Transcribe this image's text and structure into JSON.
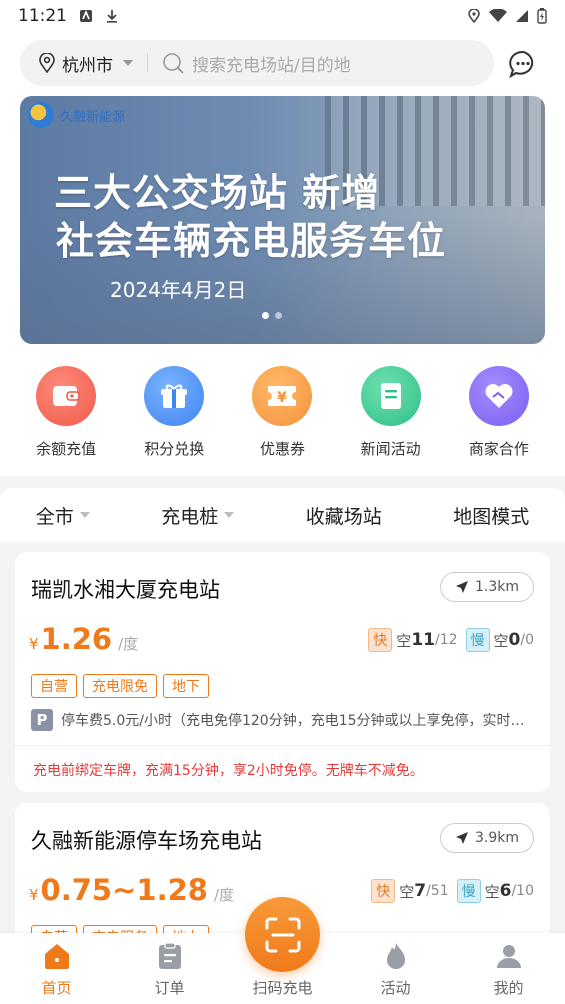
{
  "status_bar": {
    "time": "11:21"
  },
  "header": {
    "city": "杭州市",
    "search_placeholder": "搜索充电场站/目的地"
  },
  "banner": {
    "logo_text": "久融新能源",
    "headline_1": "三大公交场站 新增",
    "headline_2": "社会车辆充电服务车位",
    "date": "2024年4月2日",
    "slide_count": 2,
    "active_slide": 1
  },
  "quick_actions": [
    {
      "label": "余额充值",
      "icon": "wallet-icon",
      "color": "#f06a5a"
    },
    {
      "label": "积分兑换",
      "icon": "gift-icon",
      "color": "#4a8ff0"
    },
    {
      "label": "优惠券",
      "icon": "coupon-icon",
      "color": "#f59a3c"
    },
    {
      "label": "新闻活动",
      "icon": "news-icon",
      "color": "#3cc48e"
    },
    {
      "label": "商家合作",
      "icon": "handshake-icon",
      "color": "#8a6cf0"
    }
  ],
  "filter_tabs": [
    {
      "label": "全市",
      "dropdown": true
    },
    {
      "label": "充电桩",
      "dropdown": true
    },
    {
      "label": "收藏场站",
      "dropdown": false
    },
    {
      "label": "地图模式",
      "dropdown": false
    }
  ],
  "stations": [
    {
      "name": "瑞凯水湘大厦充电站",
      "distance": "1.3km",
      "currency": "¥",
      "price": "1.26",
      "unit": "/度",
      "fast_label": "快",
      "fast_free": "11",
      "fast_total": "/12",
      "slow_label": "慢",
      "slow_free": "0",
      "slow_total": "/0",
      "free_label": "空",
      "tags": [
        "自营",
        "充电限免",
        "地下"
      ],
      "parking_icon": "P",
      "parking": "停车费5.0元/小时（充电免停120分钟，充电15分钟或以上享免停，实时计费）",
      "notice": "充电前绑定车牌，充满15分钟，享2小时免停。无牌车不减免。"
    },
    {
      "name": "久融新能源停车场充电站",
      "distance": "3.9km",
      "currency": "¥",
      "price": "0.75~1.28",
      "unit": "/度",
      "fast_label": "快",
      "fast_free": "7",
      "fast_total": "/51",
      "slow_label": "慢",
      "slow_free": "6",
      "slow_total": "/10",
      "free_label": "空",
      "tags": [
        "自营",
        "充电服务",
        "地上"
      ]
    }
  ],
  "bottom_nav": [
    {
      "label": "首页",
      "icon": "home-icon",
      "active": true
    },
    {
      "label": "订单",
      "icon": "order-icon",
      "active": false
    },
    {
      "label": "扫码充电",
      "icon": "scan-icon",
      "active": false
    },
    {
      "label": "活动",
      "icon": "fire-icon",
      "active": false
    },
    {
      "label": "我的",
      "icon": "user-icon",
      "active": false
    }
  ],
  "colors": {
    "accent": "#f07a1a",
    "warning_text": "#e83a3a"
  }
}
